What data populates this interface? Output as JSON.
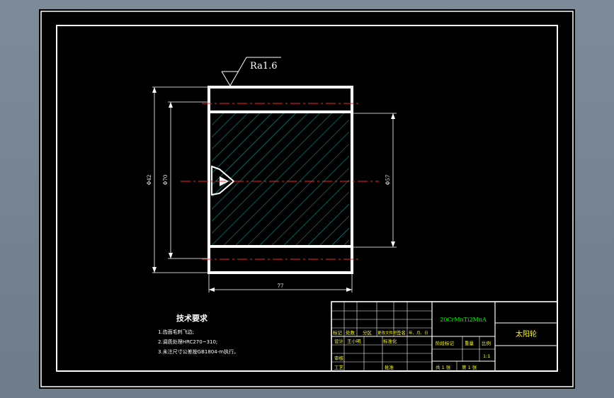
{
  "drawing": {
    "roughness": "Ra1.6",
    "dims": {
      "outer_dia": "Φ42",
      "inner_dia": "Φ70",
      "bore_dia": "Φ57",
      "length": "77"
    },
    "tech_title": "技术要求",
    "tech_notes": [
      "1.齿面毛刺飞边;",
      "2.调质处理HRC270~310;",
      "3.未注尺寸公差按GB1804-m执行。"
    ],
    "title_block": {
      "material": "20CrMnTi2MnA",
      "part_name": "太阳轮",
      "col_headers": [
        "标记",
        "处数",
        "分区",
        "更改文件号",
        "签名",
        "年、月、日"
      ],
      "design_label": "设计",
      "designer": "王小明",
      "standard_label": "标准化",
      "check_label": "审核",
      "process_label": "工艺",
      "approve_label": "批准",
      "stage_label": "阶段标记",
      "weight_label": "重量",
      "scale_label": "比例",
      "scale_value": "1:1",
      "sheet_total": "共 1 张",
      "sheet_no": "第 1 张"
    }
  },
  "colors": {
    "background": "#000000",
    "line": "#ffffff",
    "hatch": "#00c8c8",
    "center": "#ff2020",
    "text_yellow": "#ffff00",
    "text_green": "#00ff00"
  }
}
